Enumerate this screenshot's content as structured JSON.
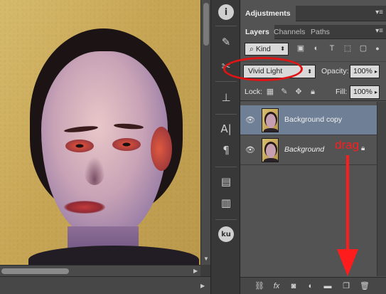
{
  "canvas": {
    "image_subject": "portrait"
  },
  "tools": [
    {
      "icon": "info-icon",
      "glyph": "i"
    },
    {
      "icon": "brush-adjust-icon",
      "glyph": "✎"
    },
    {
      "icon": "tool-preset-icon",
      "glyph": "✂"
    },
    {
      "icon": "stamp-icon",
      "glyph": "⊥"
    },
    {
      "icon": "character-icon",
      "glyph": "A|"
    },
    {
      "icon": "paragraph-icon",
      "glyph": "¶"
    },
    {
      "icon": "notes-icon",
      "glyph": "▤"
    },
    {
      "icon": "document-icon",
      "glyph": "▥"
    },
    {
      "icon": "ku-plugin-icon",
      "glyph": "ku"
    }
  ],
  "panel": {
    "adjustments_tab": "Adjustments",
    "tabs": [
      "Layers",
      "Channels",
      "Paths"
    ],
    "filter": {
      "kind_label": "Kind"
    },
    "blend_mode": "Vivid Light",
    "opacity_label": "Opacity:",
    "opacity_value": "100%",
    "lock_label": "Lock:",
    "fill_label": "Fill:",
    "fill_value": "100%",
    "layers": [
      {
        "name": "Background copy",
        "selected": true,
        "italic": false,
        "locked": false
      },
      {
        "name": "Background",
        "selected": false,
        "italic": true,
        "locked": true
      }
    ]
  },
  "annotation": {
    "drag_text": "drag",
    "highlight_color": "#e01414"
  },
  "colors": {
    "panel_bg": "#535353",
    "selected_layer": "#6f7f96",
    "annotation_red": "#ff1c1c"
  }
}
